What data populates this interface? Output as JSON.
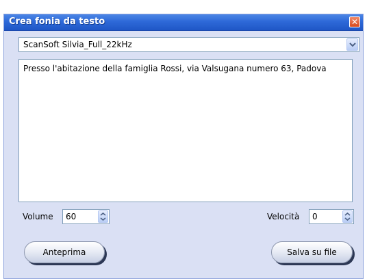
{
  "window": {
    "title": "Crea fonia da testo",
    "close_glyph": "✕",
    "close_icon": "close-icon"
  },
  "voice": {
    "selected": "ScanSoft Silvia_Full_22kHz",
    "dropdown_icon": "chevron-down-icon"
  },
  "text": {
    "content": "Presso l'abitazione della famiglia Rossi, via Valsugana numero 63, Padova"
  },
  "volume": {
    "label": "Volume",
    "value": "60"
  },
  "speed": {
    "label": "Velocità",
    "value": "0"
  },
  "buttons": {
    "preview": "Anteprima",
    "save": "Salva su file"
  },
  "colors": {
    "titlebar": "#2e69d8",
    "window_bg": "#dae0f4",
    "close": "#d74a1c",
    "button_shadow": "#2d3855"
  }
}
